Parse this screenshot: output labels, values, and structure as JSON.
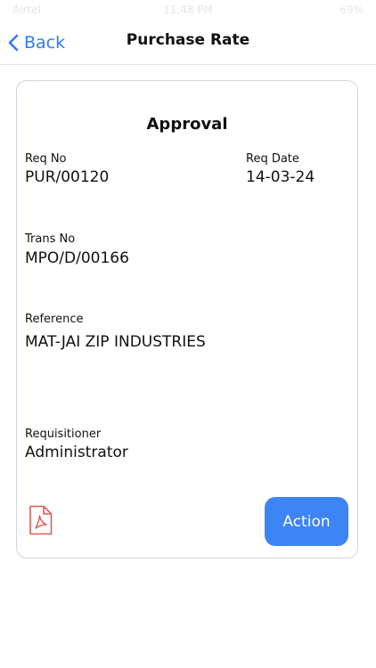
{
  "status_bar": {
    "carrier": "Airtel",
    "time": "11:48 PM",
    "battery": "69%"
  },
  "nav": {
    "back_label": "Back",
    "title": "Purchase Rate"
  },
  "card": {
    "title": "Approval",
    "fields": {
      "req_no": {
        "label": "Req No",
        "value": "PUR/00120"
      },
      "req_date": {
        "label": "Req Date",
        "value": "14-03-24"
      },
      "trans_no": {
        "label": "Trans No",
        "value": "MPO/D/00166"
      },
      "reference": {
        "label": "Reference",
        "value": "MAT-JAI ZIP INDUSTRIES"
      },
      "requisitioner": {
        "label": "Requisitioner",
        "value": "Administrator"
      }
    },
    "pdf_icon": "pdf-document-icon",
    "action_label": "Action"
  },
  "colors": {
    "accent": "#3d84f7",
    "back_link": "#2f7bf5",
    "pdf_icon": "#e05a5a",
    "card_border": "#cfd4e0"
  }
}
